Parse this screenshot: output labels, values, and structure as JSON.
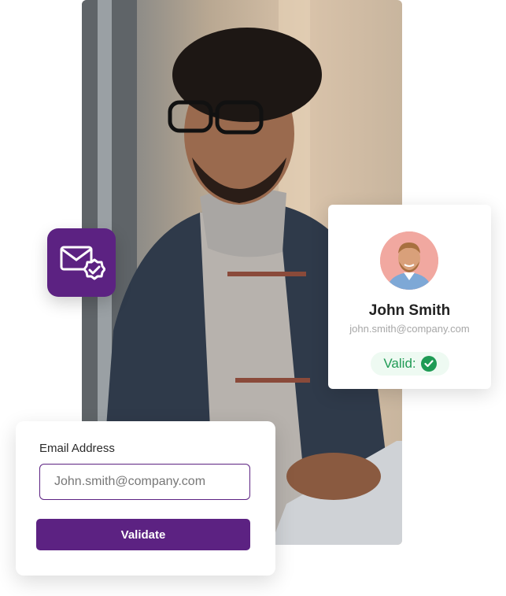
{
  "profile_card": {
    "name": "John Smith",
    "email": "john.smith@company.com",
    "status_label": "Valid:",
    "status_icon": "check-circle-icon"
  },
  "form": {
    "label": "Email Address",
    "input_value": "John.smith@company.com",
    "button_label": "Validate"
  },
  "badge_icon": "mail-verified-icon",
  "colors": {
    "brand_purple": "#5c2282",
    "valid_green": "#1f9b55",
    "valid_bg": "#eefaf2"
  }
}
